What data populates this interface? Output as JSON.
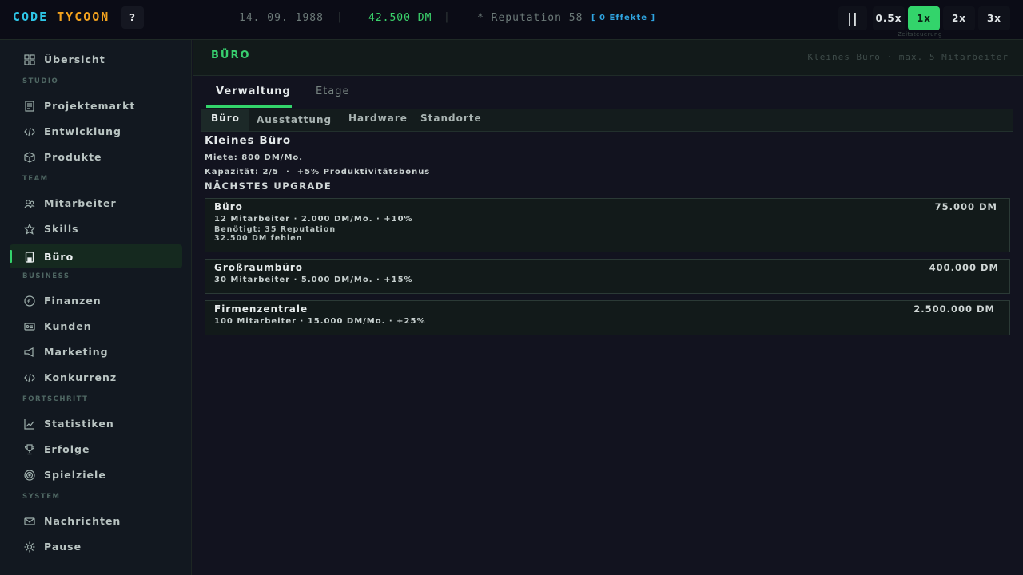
{
  "app": {
    "logo_code": "CODE",
    "logo_tycoon": "TYCOON",
    "help": "?"
  },
  "status": {
    "date": "14. 09. 1988",
    "separator": "|",
    "money": "42.500 DM",
    "reputation": "* Reputation 58",
    "effects": "[ 0 Effekte ]"
  },
  "time_controls": {
    "pause": "||",
    "speeds": [
      "0.5x",
      "1x",
      "2x",
      "3x"
    ],
    "active_speed": "1x",
    "label": "Zeitsteuerung"
  },
  "sidebar": {
    "overview": "Übersicht",
    "sections": {
      "studio": "STUDIO",
      "team": "TEAM",
      "business": "BUSINESS",
      "progress": "FORTSCHRITT",
      "system": "SYSTEM"
    },
    "items": {
      "projektemarkt": "Projektemarkt",
      "entwicklung": "Entwicklung",
      "produkte": "Produkte",
      "mitarbeiter": "Mitarbeiter",
      "skills": "Skills",
      "buero": "Büro",
      "finanzen": "Finanzen",
      "kunden": "Kunden",
      "marketing": "Marketing",
      "konkurrenz": "Konkurrenz",
      "statistiken": "Statistiken",
      "erfolge": "Erfolge",
      "spielziele": "Spielziele",
      "nachrichten": "Nachrichten",
      "pause": "Pause"
    },
    "active": "Büro"
  },
  "page": {
    "title": "BÜRO",
    "meta": "Kleines Büro  ·  max. 5 Mitarbeiter",
    "tabs": [
      "Verwaltung",
      "Etage"
    ],
    "active_tab": "Verwaltung",
    "subtabs": [
      "Büro",
      "Ausstattung",
      "Hardware",
      "Standorte"
    ],
    "active_subtab": "Büro"
  },
  "office": {
    "name": "Kleines Büro",
    "rent": "Miete: 800 DM/Mo.",
    "capacity": "Kapazität: 2/5  ·  +5% Produktivitätsbonus",
    "upgrade_heading": "NÄCHSTES UPGRADE"
  },
  "upgrades": [
    {
      "name": "Büro",
      "price": "75.000 DM",
      "specs": "12 Mitarbeiter · 2.000 DM/Mo. · +10%",
      "requirement": "Benötigt: 35 Reputation",
      "missing": "32.500 DM fehlen"
    },
    {
      "name": "Großraumbüro",
      "price": "400.000 DM",
      "specs": "30 Mitarbeiter · 5.000 DM/Mo. · +15%"
    },
    {
      "name": "Firmenzentrale",
      "price": "2.500.000 DM",
      "specs": "100 Mitarbeiter · 15.000 DM/Mo. · +25%"
    }
  ],
  "colors": {
    "accent_green": "#33d46b",
    "logo_blue": "#2ec5e6",
    "logo_orange": "#f2a21e",
    "effects_blue": "#2fa4e0"
  }
}
